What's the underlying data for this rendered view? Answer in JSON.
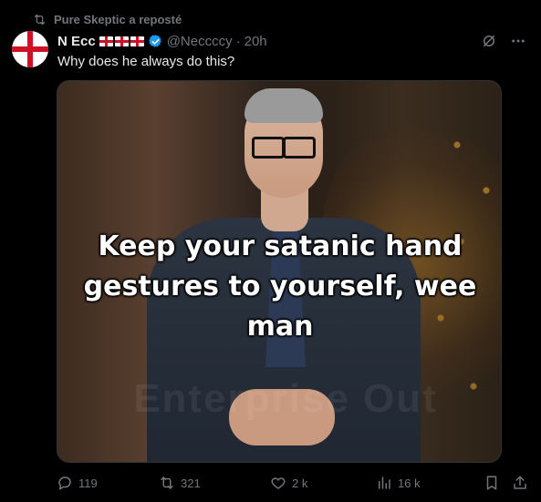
{
  "repost_header": {
    "icon": "repost-icon",
    "text": "Pure Skeptic a reposté"
  },
  "tweet": {
    "author_name": "N Ecc",
    "author_emoji": [
      "england-flag",
      "england-flag",
      "england-flag"
    ],
    "verified_icon": "verified-badge-icon",
    "handle": "@Neccccy",
    "separator": "·",
    "time": "20h",
    "text": "Why does he always do this?",
    "media_caption": "Keep your satanic hand gestures to yourself, wee man",
    "media_caption_lines": [
      "Keep your satanic hand",
      "gestures to yourself, wee",
      "man"
    ],
    "media_watermark": "Enterprise Out"
  },
  "top_icons": {
    "grok": "grok-icon",
    "more": "more-icon"
  },
  "actions": {
    "reply_count": "119",
    "repost_count": "321",
    "like_count": "2 k",
    "views_count": "16 k",
    "bookmark": "bookmark-icon",
    "share": "share-icon"
  },
  "colors": {
    "background": "#000000",
    "text": "#e7e9ea",
    "muted": "#71767b",
    "verified": "#1d9bf0",
    "england_red": "#ce1124"
  }
}
